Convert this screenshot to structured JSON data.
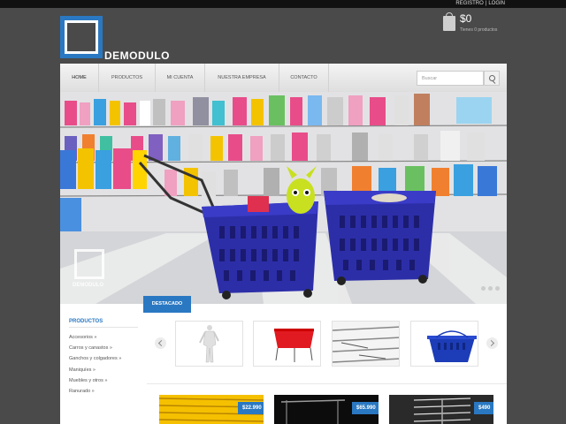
{
  "header": {
    "links": [
      "REGISTRO",
      "LOGIN"
    ],
    "separator": "|",
    "logo": "DEMODULO",
    "cart": {
      "total": "$0",
      "count_text": "Tienes 0 productos"
    }
  },
  "nav": {
    "items": [
      "HOME",
      "PRODUCTOS",
      "MI CUENTA",
      "NUESTRA EMPRESA",
      "CONTACTO"
    ],
    "search_placeholder": "Buscar"
  },
  "hero": {
    "watermark": "DEMODULO",
    "slide_count": 3
  },
  "sidebar": {
    "title": "PRODUCTOS",
    "items": [
      "Accesorios »",
      "Carros y canastos »",
      "Ganchos y colgadores »",
      "Maniquíes »",
      "Muebles y otros »",
      "Ranurado »"
    ]
  },
  "featured": {
    "tab": "DESTACADO",
    "thumbnails": [
      "mannequin-icon",
      "red-basket-icon",
      "slatwall-hooks-icon",
      "blue-basket-icon"
    ]
  },
  "products": [
    {
      "price": "$22.990",
      "image": "yellow-slatwall-panel"
    },
    {
      "price": "$65.990",
      "image": "black-rack"
    },
    {
      "price": "$490",
      "image": "slatwall-hook"
    }
  ],
  "colors": {
    "accent": "#2a78c2",
    "topbar": "#111111",
    "background": "#4a4a4a"
  }
}
